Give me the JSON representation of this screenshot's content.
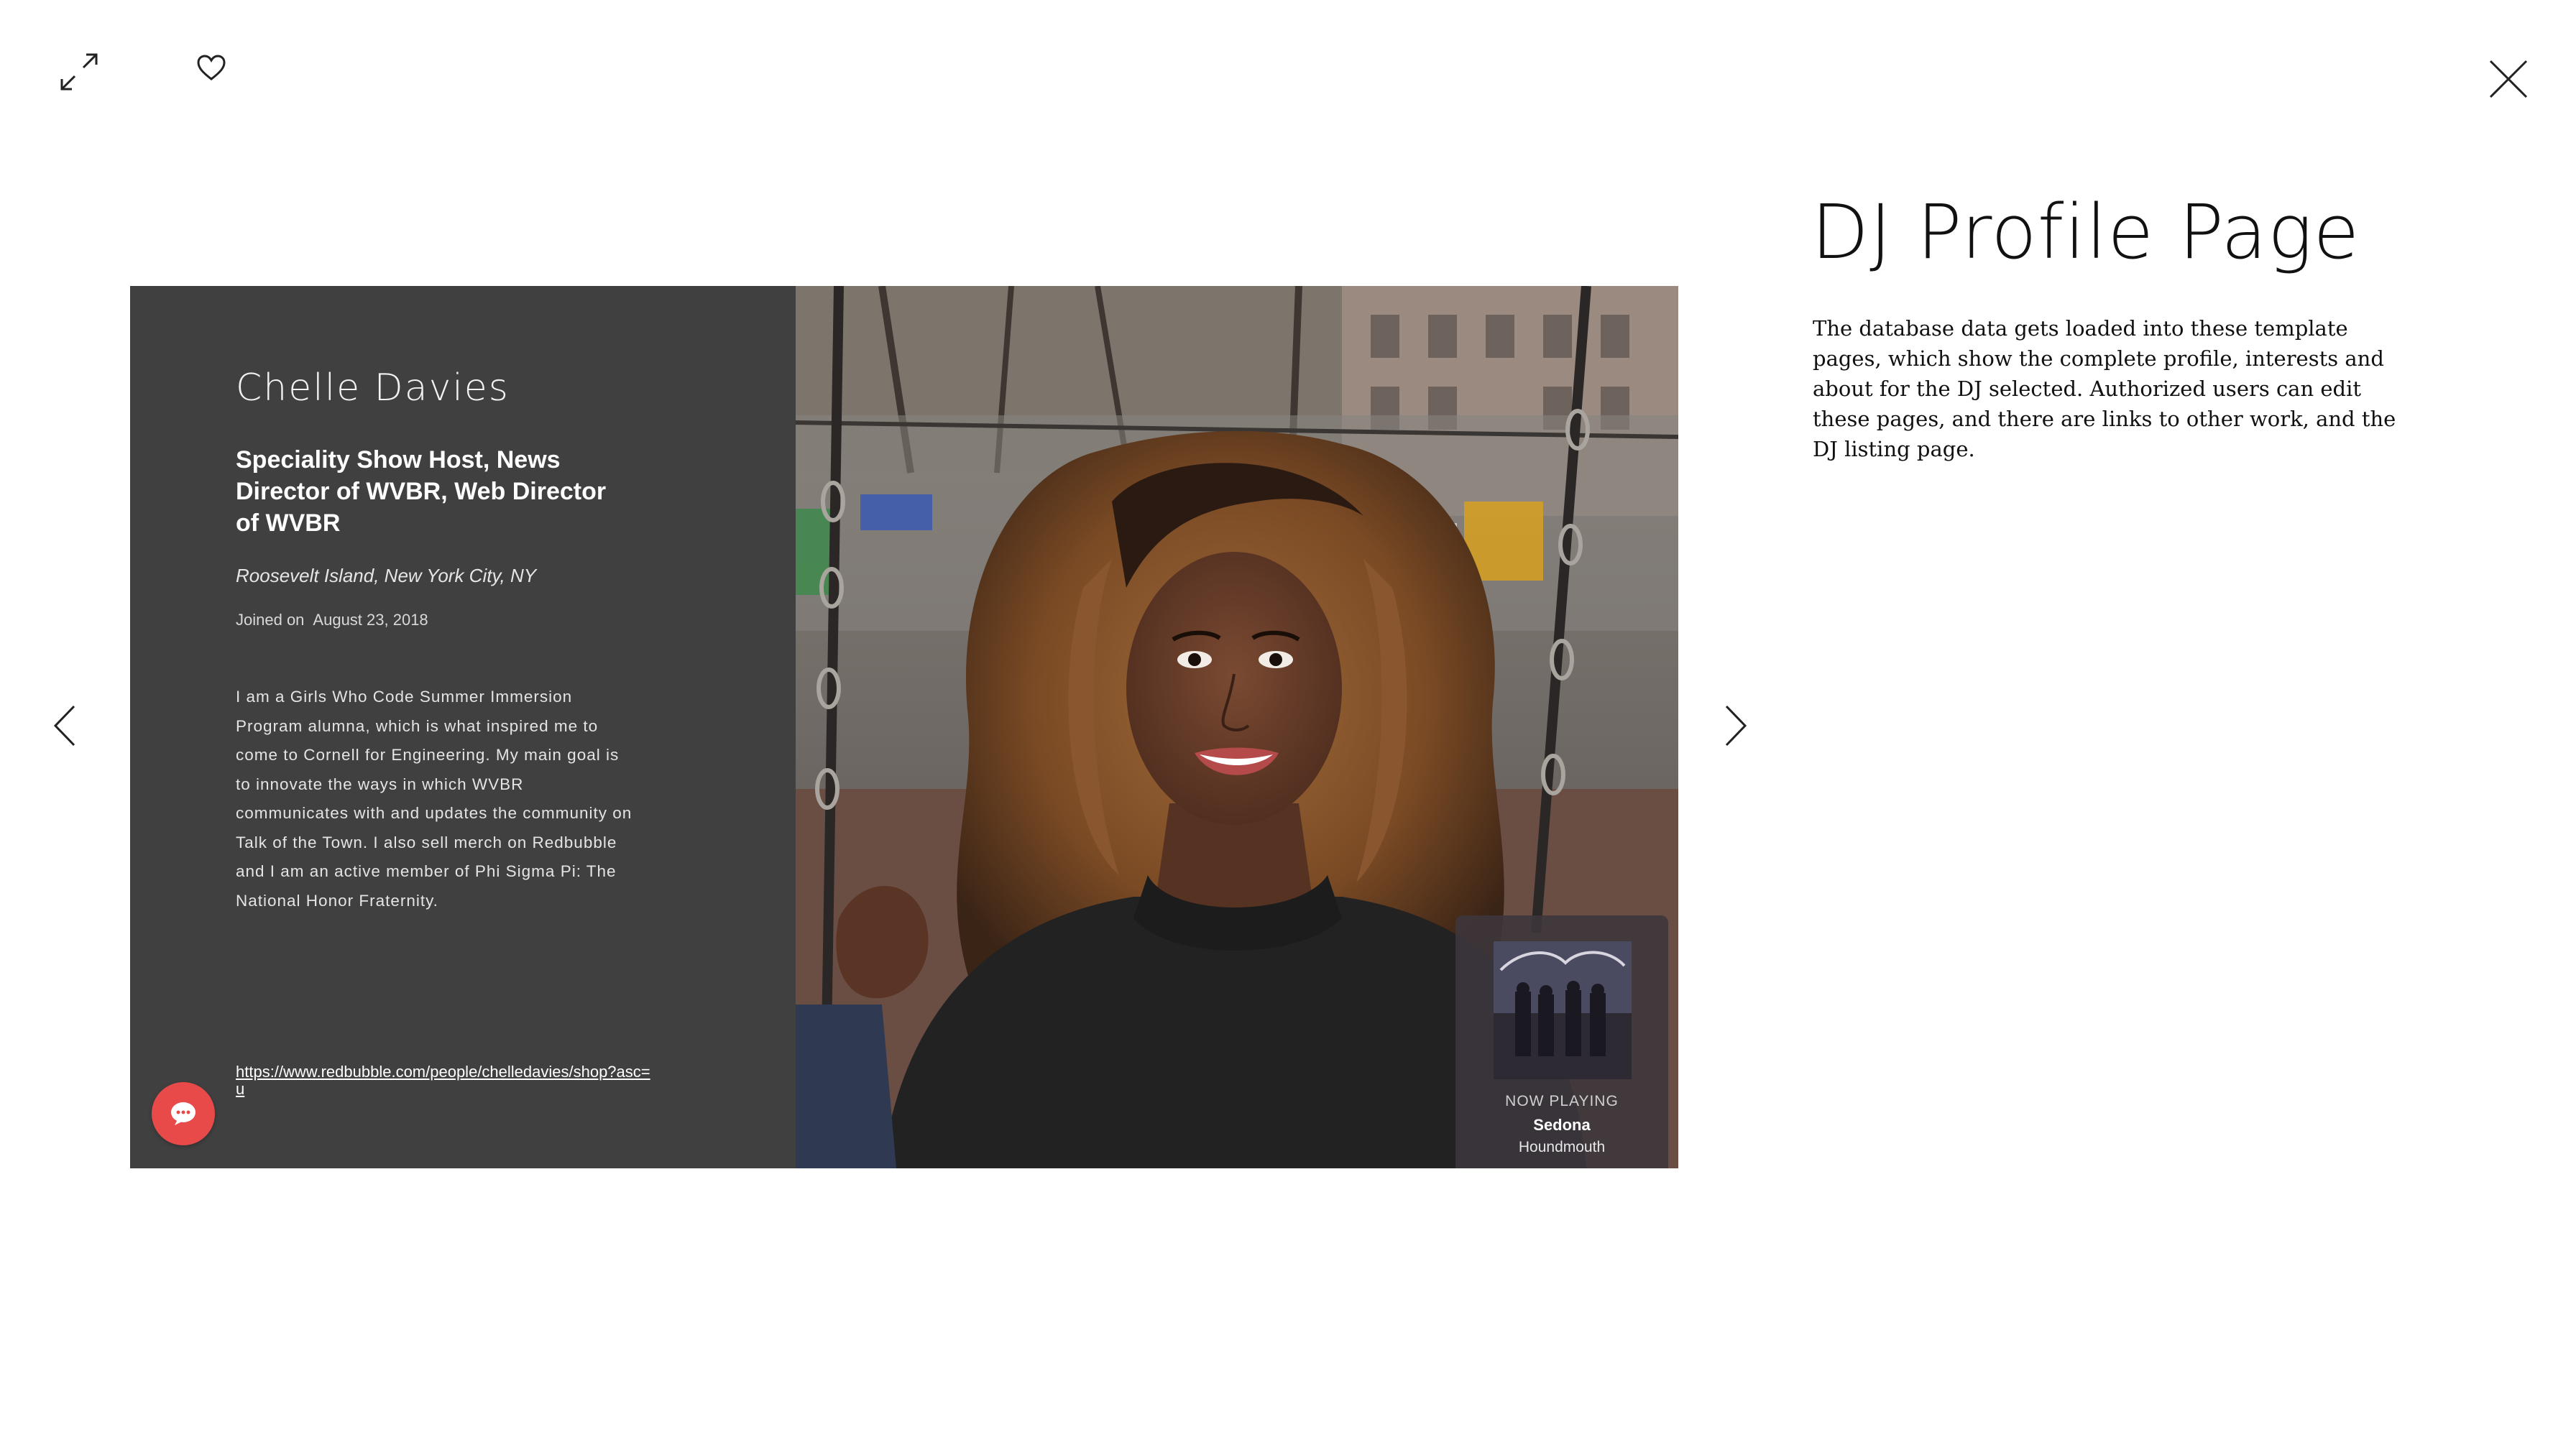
{
  "toolbar": {
    "expand_icon": "expand-arrows-icon",
    "favorite_icon": "heart-icon",
    "close_icon": "close-x-icon"
  },
  "navigation": {
    "prev_icon": "chevron-left-icon",
    "next_icon": "chevron-right-icon"
  },
  "profile": {
    "name": "Chelle Davies",
    "role": "Speciality Show Host, News Director of WVBR, Web Director of WVBR",
    "location": "Roosevelt Island, New York City, NY",
    "joined_label": "Joined on",
    "joined_date": "August 23, 2018",
    "bio": "I am a Girls Who Code Summer Immersion Program alumna, which is what inspired me to come to Cornell for Engineering. My main goal is to innovate the ways in which WVBR communicates with and updates the community on Talk of the Town. I also sell merch on Redbubble and I am an active member of Phi Sigma Pi: The National Honor Fraternity.",
    "link": "https://www.redbubble.com/people/chelledavies/shop?asc=u",
    "card_color": "#404040",
    "chat_color": "#e84a4a"
  },
  "now_playing": {
    "label": "NOW PLAYING",
    "title": "Sedona",
    "artist": "Houndmouth"
  },
  "info": {
    "title": "DJ Profile Page",
    "description": "The database data gets loaded into these template pages, which show the complete profile, interests and about for the DJ selected. Authorized users can edit these pages, and there are links to other work, and the DJ listing page."
  }
}
